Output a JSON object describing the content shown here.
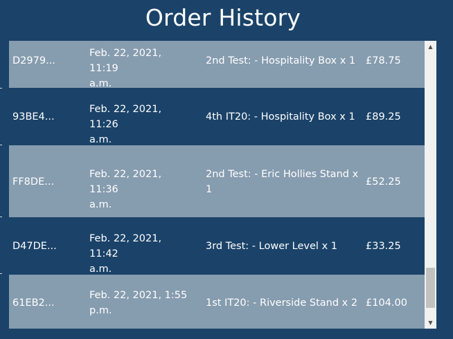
{
  "page": {
    "title": "Order History"
  },
  "orders": [
    {
      "id": "D2979...",
      "date_line1": "Feb. 22, 2021, 11:19",
      "date_line2": "a.m.",
      "item_line1": "2nd Test: - Hospitality Box x 1",
      "item_line2": "",
      "price": "£78.75"
    },
    {
      "id": "93BE4...",
      "date_line1": "Feb. 22, 2021, 11:26",
      "date_line2": "a.m.",
      "item_line1": "4th IT20: - Hospitality Box x 1",
      "item_line2": "",
      "price": "£89.25"
    },
    {
      "id": "FF8DE...",
      "date_line1": "Feb. 22, 2021, 11:36",
      "date_line2": "a.m.",
      "item_line1": "2nd Test: - Eric Hollies Stand x",
      "item_line2": "1",
      "price": "£52.25"
    },
    {
      "id": "D47DE...",
      "date_line1": "Feb. 22, 2021, 11:42",
      "date_line2": "a.m.",
      "item_line1": "3rd Test: - Lower Level x 1",
      "item_line2": "",
      "price": "£33.25"
    },
    {
      "id": "61EB2...",
      "date_line1": "Feb. 22, 2021, 1:55",
      "date_line2": "p.m.",
      "item_line1": "1st IT20: - Riverside Stand x 2",
      "item_line2": "",
      "price": "£104.00"
    }
  ],
  "scrollbar": {
    "up_icon": "arrow-up-icon",
    "down_icon": "arrow-down-icon"
  },
  "colors": {
    "background": "#1b4369",
    "row_light": "#869caf",
    "text": "#ffffff"
  }
}
